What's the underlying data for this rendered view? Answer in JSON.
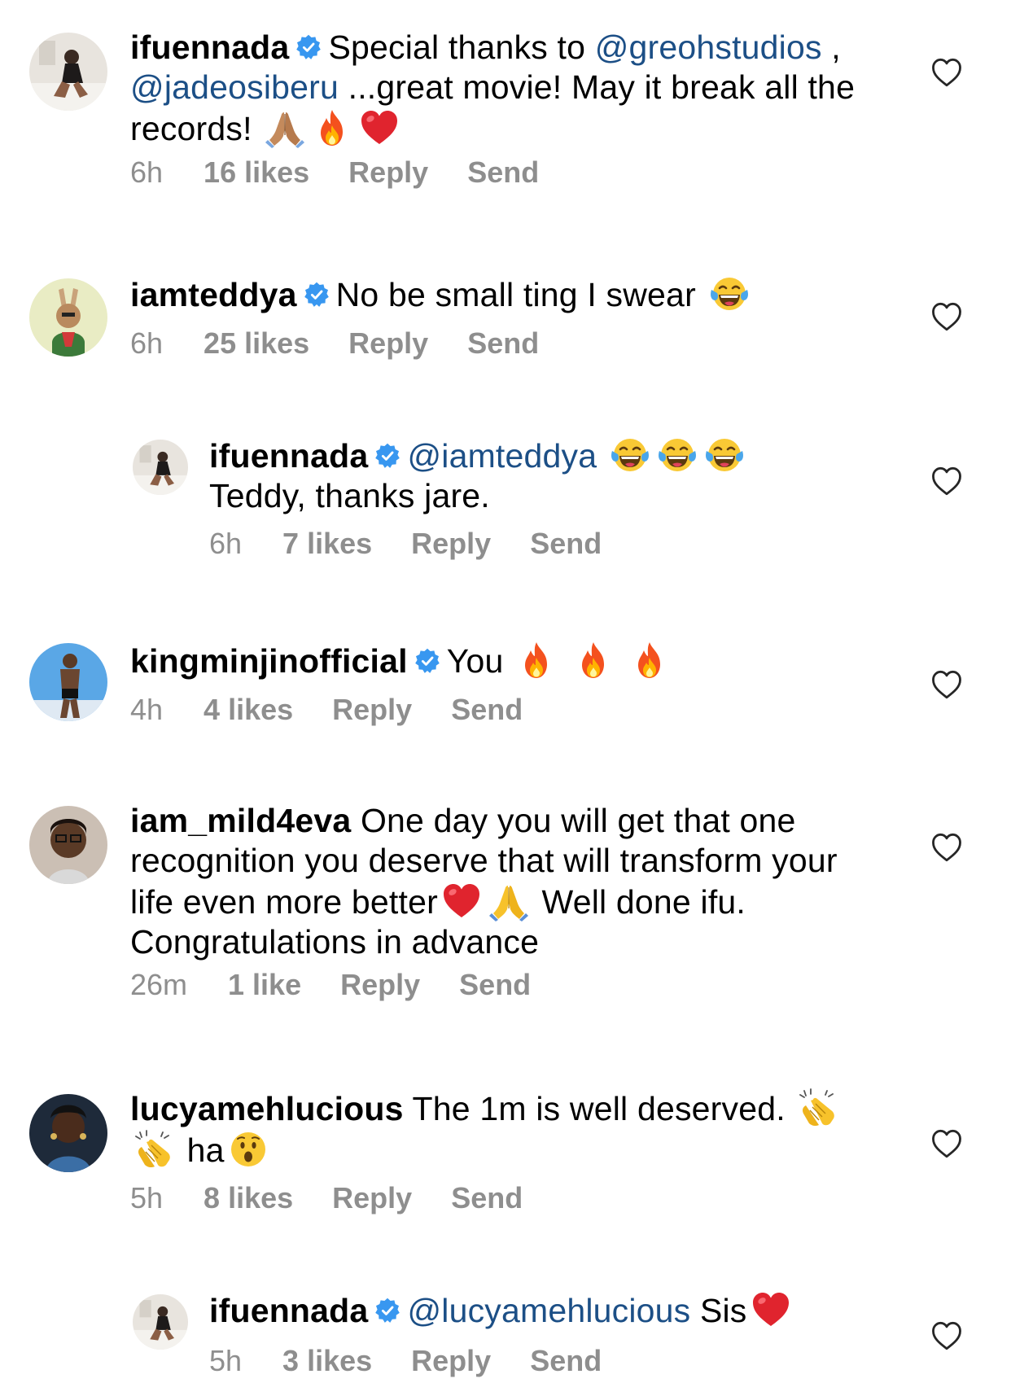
{
  "comments": [
    {
      "username": "ifuennada",
      "verified": true,
      "parts": [
        {
          "type": "text",
          "value": "Special thanks to "
        },
        {
          "type": "mention",
          "value": "@greohstudios"
        },
        {
          "type": "text",
          "value": " , "
        },
        {
          "type": "mention",
          "value": "@jadeosiberu"
        },
        {
          "type": "text",
          "value": " ...great movie! May it break all the records! "
        }
      ],
      "emojis": [
        "folded-hands-emoji",
        "fire-emoji",
        "red-heart-emoji"
      ],
      "time": "6h",
      "likes": "16 likes",
      "reply_label": "Reply",
      "send_label": "Send"
    },
    {
      "username": "iamteddya",
      "verified": true,
      "text": "No be small ting I swear",
      "emojis": [
        "tears-of-joy-emoji"
      ],
      "time": "6h",
      "likes": "25 likes",
      "reply_label": "Reply",
      "send_label": "Send"
    },
    {
      "username": "ifuennada",
      "verified": true,
      "mention": "@iamteddya",
      "emojis": [
        "tears-of-joy-emoji",
        "tears-of-joy-emoji",
        "tears-of-joy-emoji"
      ],
      "text": "Teddy, thanks jare.",
      "time": "6h",
      "likes": "7 likes",
      "reply_label": "Reply",
      "send_label": "Send"
    },
    {
      "username": "kingminjinofficial",
      "verified": true,
      "text": "You",
      "emojis": [
        "fire-emoji",
        "fire-emoji",
        "fire-emoji"
      ],
      "time": "4h",
      "likes": "4 likes",
      "reply_label": "Reply",
      "send_label": "Send"
    },
    {
      "username": "iam_mild4eva",
      "verified": false,
      "text_before": "One day you will get that one recognition you deserve that will transform your life even more better",
      "emojis": [
        "red-heart-emoji",
        "folded-hands-emoji"
      ],
      "text_after": "Well done ifu. Congratulations in advance",
      "time": "26m",
      "likes": "1 like",
      "reply_label": "Reply",
      "send_label": "Send"
    },
    {
      "username": "lucyamehlucious",
      "verified": false,
      "text": "The 1m is well deserved.",
      "text_after": "ha",
      "emojis": [
        "clapping-hands-emoji",
        "clapping-hands-emoji",
        "astonished-face-emoji"
      ],
      "time": "5h",
      "likes": "8 likes",
      "reply_label": "Reply",
      "send_label": "Send"
    },
    {
      "username": "ifuennada",
      "verified": true,
      "mention": "@lucyamehlucious",
      "text": "Sis",
      "emojis": [
        "red-heart-emoji"
      ],
      "time": "5h",
      "likes": "3 likes",
      "reply_label": "Reply",
      "send_label": "Send"
    }
  ],
  "colors": {
    "mention": "#1c4f86",
    "meta": "#8e8e8e",
    "verified": "#3897f0"
  }
}
